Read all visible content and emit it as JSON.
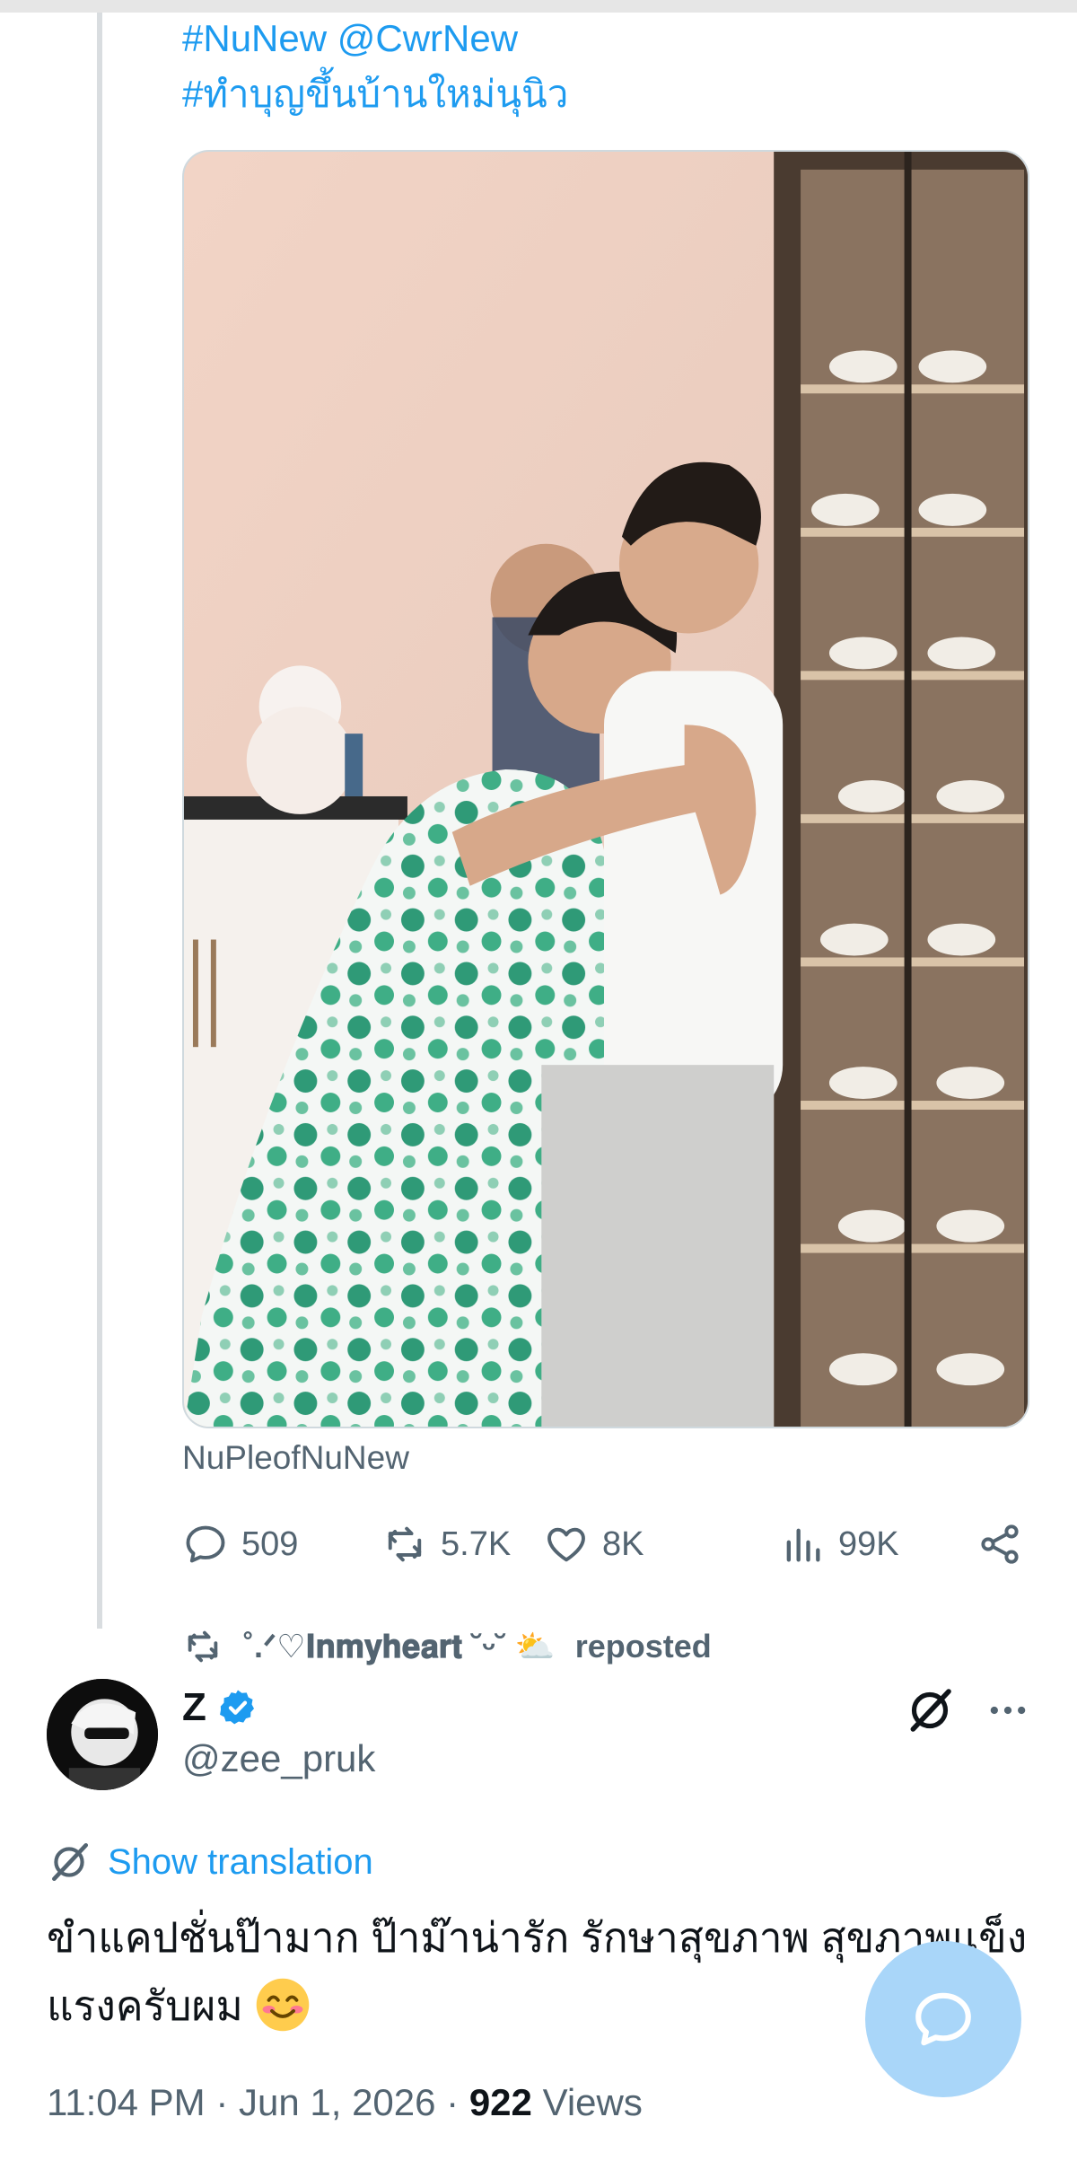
{
  "post": {
    "hashtags": [
      "#NuNew  @CwrNew",
      "#ทำบุญขึ้นบ้านใหม่นุนิว"
    ],
    "source_label": "NuPleofNuNew",
    "stats": {
      "replies": "509",
      "reposts": "5.7K",
      "likes": "8K",
      "views": "99K"
    }
  },
  "repost_banner": {
    "user": "˚.ᐟ♡𝐈𝐧𝐦𝐲𝐡𝐞𝐚𝐫𝐭 ˘ᵕ˘ ⛅",
    "suffix": "reposted"
  },
  "tweet": {
    "display_name": "Z",
    "handle": "@zee_pruk",
    "translate_label": "Show translation",
    "text": "ขำแคปชั่นป๊ามาก ป๊าม๊าน่ารัก รักษาสุขภาพ สุขภาพแข็งแรงครับผม",
    "time": "11:04 PM",
    "date": "Jun 1, 2026",
    "views_count": "922",
    "views_label": "Views"
  },
  "icons": {
    "reply": "reply-icon",
    "repost": "repost-icon",
    "like": "heart-icon",
    "views": "views-bar-icon",
    "share": "share-icon",
    "verified": "verified-badge-icon",
    "grok": "grok-icon",
    "more": "more-icon",
    "translate": "translate-icon",
    "compose": "message-bubble-icon"
  },
  "colors": {
    "link": "#1d9bf0",
    "secondary_text": "#536471",
    "primary_text": "#0f1419",
    "fab": "#a9d6f9"
  }
}
